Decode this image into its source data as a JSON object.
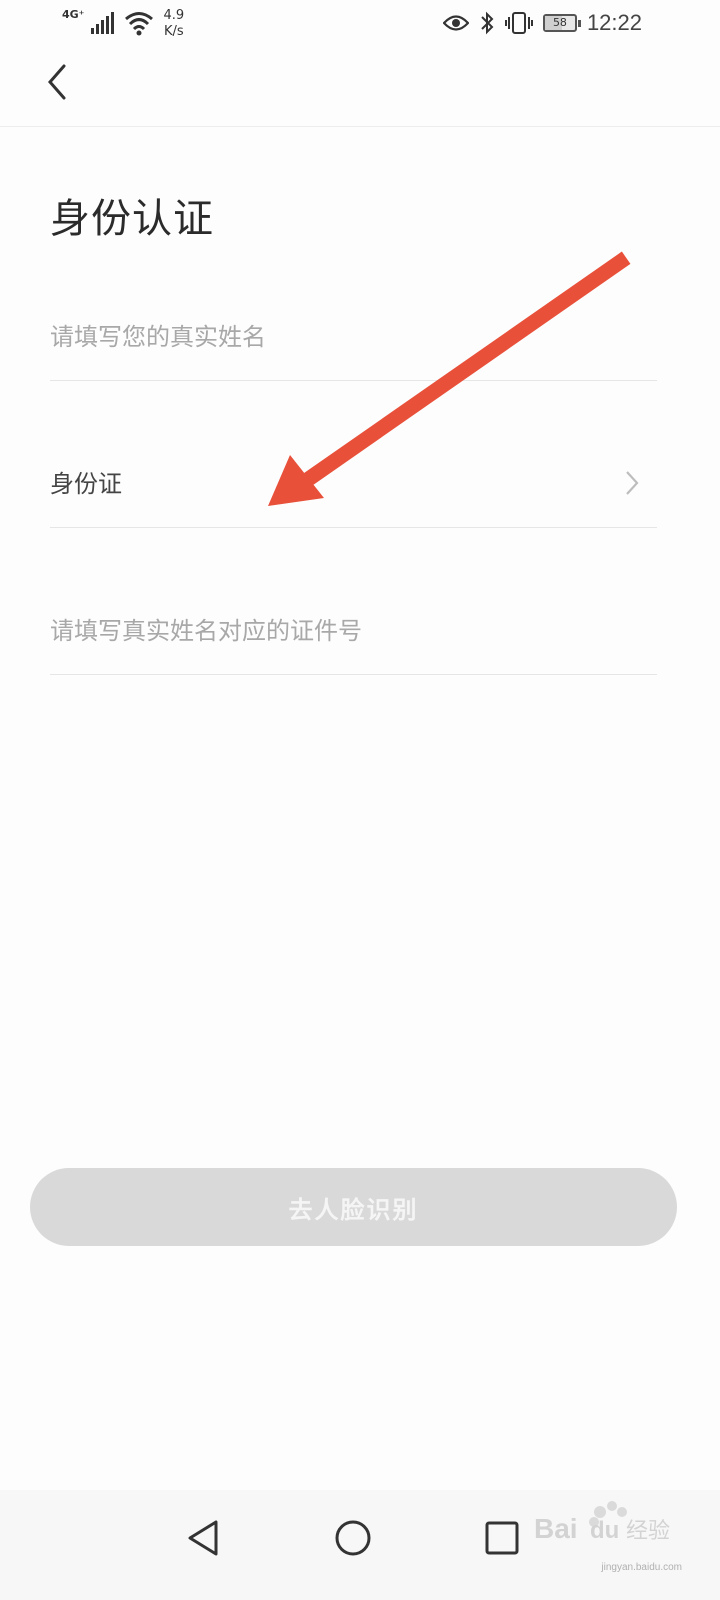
{
  "status_bar": {
    "network_type": "4G⁺",
    "speed_value": "4.9",
    "speed_unit": "K/s",
    "battery_level": "58",
    "time": "12:22"
  },
  "header": {
    "back_icon": "chevron-left-icon"
  },
  "page": {
    "title": "身份认证"
  },
  "form": {
    "name_placeholder": "请填写您的真实姓名",
    "id_type_value": "身份证",
    "id_number_placeholder": "请填写真实姓名对应的证件号"
  },
  "actions": {
    "face_recognition_label": "去人脸识别"
  },
  "annotation": {
    "arrow_color": "#e8503a"
  },
  "nav": {
    "back_icon": "triangle-back-icon",
    "home_icon": "circle-home-icon",
    "recents_icon": "square-recents-icon"
  },
  "watermark": {
    "brand": "Bai du 经验",
    "url": "jingyan.baidu.com"
  },
  "colors": {
    "button_disabled": "#d9d9d9",
    "placeholder": "#a8a8a8",
    "divider": "#e6e6e6"
  }
}
